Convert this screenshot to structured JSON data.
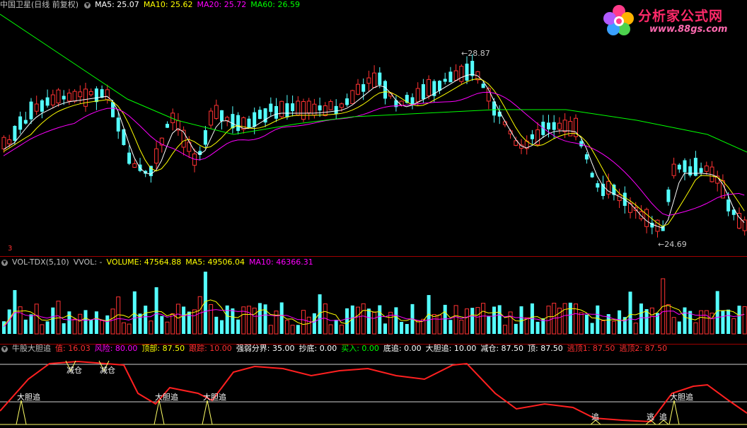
{
  "price": {
    "stock_name": "中国卫星",
    "period": "(日线 前复权)",
    "ma5": "MA5: 25.07",
    "ma10": "MA10: 25.62",
    "ma20": "MA20: 25.72",
    "ma60": "MA60: 26.59",
    "high_label": "28.87",
    "low_label": "24.69",
    "marker": "3"
  },
  "volume": {
    "title": "VOL-TDX(5,10)",
    "vvol": "VVOL: -",
    "volume": "VOLUME: 47564.88",
    "ma5": "MA5: 49506.04",
    "ma10": "MA10: 46366.31"
  },
  "indicator": {
    "title": "牛股大胆追",
    "values": [
      {
        "text": "值: 16.03",
        "color": "#ff3030"
      },
      {
        "text": "风险: 80.00",
        "color": "#ff00ff"
      },
      {
        "text": "顶部: 87.50",
        "color": "#ffff00"
      },
      {
        "text": "跟踪: 10.00",
        "color": "#ff3030"
      },
      {
        "text": "强弱分界: 35.00",
        "color": "#ffffff"
      },
      {
        "text": "抄底: 0.00",
        "color": "#ffffff"
      },
      {
        "text": "买入: 0.00",
        "color": "#00ff00"
      },
      {
        "text": "底追: 0.00",
        "color": "#ffffff"
      },
      {
        "text": "大胆追: 10.00",
        "color": "#ffffff"
      },
      {
        "text": "减仓: 87.50",
        "color": "#ffffff"
      },
      {
        "text": "顶: 87.50",
        "color": "#ffffff"
      },
      {
        "text": "逃顶1: 87.50",
        "color": "#ff3030"
      },
      {
        "text": "逃顶2: 87.50",
        "color": "#ff3030"
      }
    ],
    "signals": [
      "减仓",
      "减仓",
      "大胆追",
      "大胆追",
      "大胆追",
      "追",
      "逃",
      "追",
      "大胆追"
    ]
  },
  "logo": {
    "text": "分析家公式网",
    "url": "www.88gs.com"
  },
  "colors": {
    "up": "#ff3232",
    "down": "#54ffff",
    "ma5": "#ffffff",
    "ma10": "#ffff00",
    "ma20": "#ff00ff",
    "ma60": "#00ff00"
  }
}
